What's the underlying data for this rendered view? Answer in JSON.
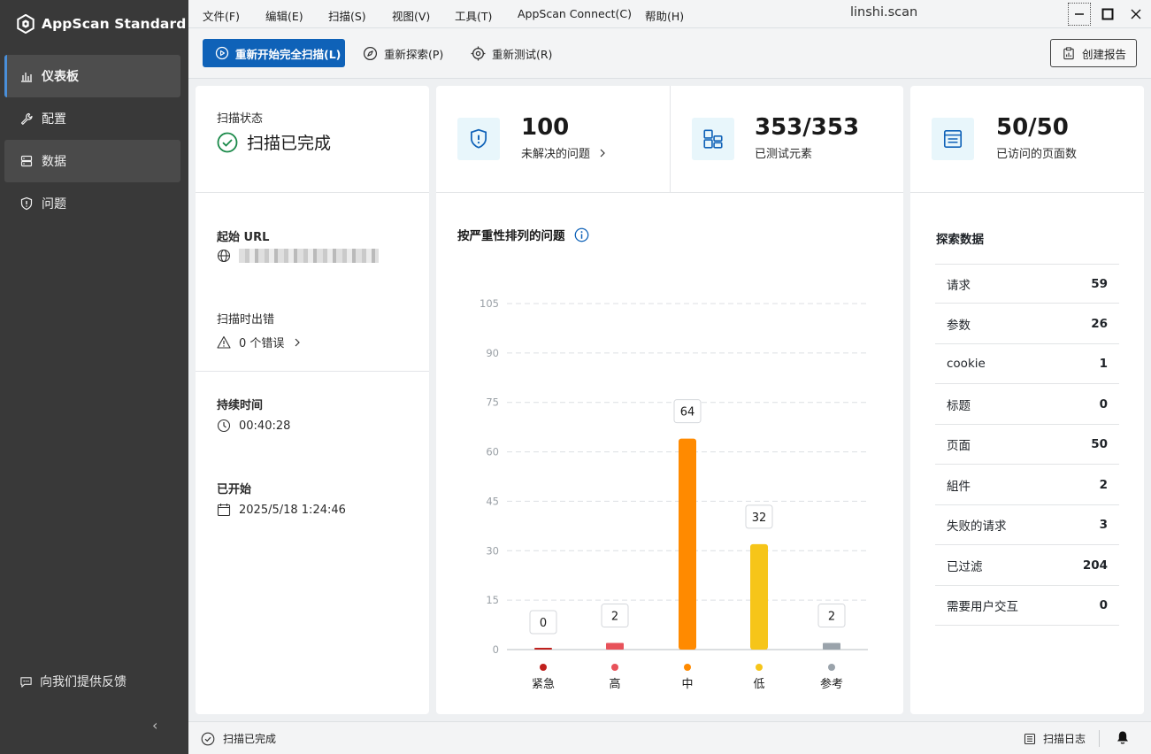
{
  "app": {
    "name": "AppScan Standard",
    "window_title": "linshi.scan"
  },
  "sidebar": {
    "items": [
      {
        "label": "仪表板",
        "icon": "bar-chart-icon"
      },
      {
        "label": "配置",
        "icon": "wrench-icon"
      },
      {
        "label": "数据",
        "icon": "database-icon"
      },
      {
        "label": "问题",
        "icon": "shield-alert-icon"
      }
    ],
    "feedback_label": "向我们提供反馈",
    "collapse_glyph": "‹"
  },
  "menu": [
    {
      "label": "文件(F)"
    },
    {
      "label": "编辑(E)"
    },
    {
      "label": "扫描(S)"
    },
    {
      "label": "视图(V)"
    },
    {
      "label": "工具(T)"
    },
    {
      "label": "AppScan Connect(C)"
    },
    {
      "label": "帮助(H)"
    }
  ],
  "toolbar": {
    "rescan_full": "重新开始完全扫描(L)",
    "re_explore": "重新探索(P)",
    "re_test": "重新测试(R)",
    "create_report": "创建报告"
  },
  "scan_status": {
    "title": "扫描状态",
    "status": "扫描已完成"
  },
  "start_url": {
    "label": "起始 URL"
  },
  "scan_errors": {
    "label": "扫描时出错",
    "value": "0 个错误"
  },
  "duration": {
    "label": "持续时间",
    "value": "00:40:28"
  },
  "started": {
    "label": "已开始",
    "value": "2025/5/18 1:24:46"
  },
  "stats": {
    "issues": {
      "value": "100",
      "label": "未解决的问题"
    },
    "elements": {
      "value": "353/353",
      "label": "已测试元素"
    },
    "pages": {
      "value": "50/50",
      "label": "已访问的页面数"
    }
  },
  "chart_title": "按严重性排列的问题",
  "chart_data": {
    "type": "bar",
    "title": "按严重性排列的问题",
    "categories": [
      "紧急",
      "高",
      "中",
      "低",
      "参考"
    ],
    "values": [
      0,
      2,
      64,
      32,
      2
    ],
    "colors": [
      "#c0201d",
      "#e8525a",
      "#ff8a00",
      "#f6c519",
      "#9aa3ab"
    ],
    "ylim": [
      0,
      105
    ],
    "yticks": [
      0,
      15,
      30,
      45,
      60,
      75,
      90,
      105
    ],
    "grid": true
  },
  "explore": {
    "title": "探索数据",
    "rows": [
      {
        "label": "请求",
        "value": "59"
      },
      {
        "label": "参数",
        "value": "26"
      },
      {
        "label": "cookie",
        "value": "1"
      },
      {
        "label": "标题",
        "value": "0"
      },
      {
        "label": "页面",
        "value": "50"
      },
      {
        "label": "組件",
        "value": "2"
      },
      {
        "label": "失败的请求",
        "value": "3"
      },
      {
        "label": "已过滤",
        "value": "204"
      },
      {
        "label": "需要用户交互",
        "value": "0"
      }
    ]
  },
  "statusbar": {
    "status": "扫描已完成",
    "log": "扫描日志"
  }
}
